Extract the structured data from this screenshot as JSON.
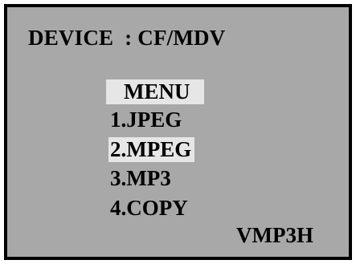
{
  "device": {
    "label": "DEVICE  : CF/MDV"
  },
  "menu": {
    "title": "MENU",
    "items": [
      {
        "label": "1.JPEG",
        "selected": false
      },
      {
        "label": "2.MPEG",
        "selected": true
      },
      {
        "label": "3.MP3",
        "selected": false
      },
      {
        "label": "4.COPY",
        "selected": false
      }
    ]
  },
  "model": {
    "label": "VMP3H"
  },
  "colors": {
    "screen_background": "#a8a8a8",
    "highlight": "#e6e6e6",
    "text": "#000000",
    "border": "#000000"
  }
}
